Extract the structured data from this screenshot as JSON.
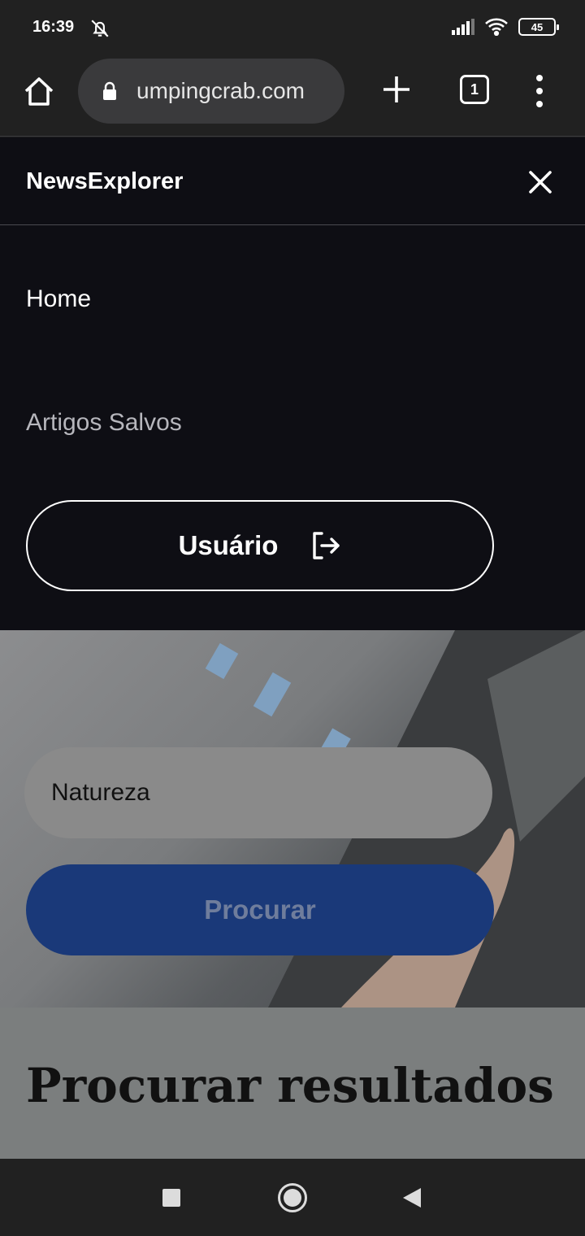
{
  "status_bar": {
    "time": "16:39",
    "battery": "45",
    "icons": [
      "bell-off-icon",
      "signal-icon",
      "wifi-icon",
      "battery-icon"
    ]
  },
  "browser": {
    "url": "umpingcrab.com",
    "tab_count": "1",
    "icons": [
      "home-icon",
      "lock-icon",
      "plus-icon",
      "tabs-icon",
      "more-vert-icon"
    ]
  },
  "drawer": {
    "brand": "NewsExplorer",
    "nav": {
      "home": "Home",
      "saved": "Artigos Salvos"
    },
    "user_button": "Usuário"
  },
  "search": {
    "value": "Natureza",
    "button": "Procurar"
  },
  "results": {
    "title": "Procurar resultados"
  },
  "colors": {
    "drawer_bg": "#0e0e14",
    "search_button": "#1a3979",
    "results_bg": "#7b7e7e"
  }
}
